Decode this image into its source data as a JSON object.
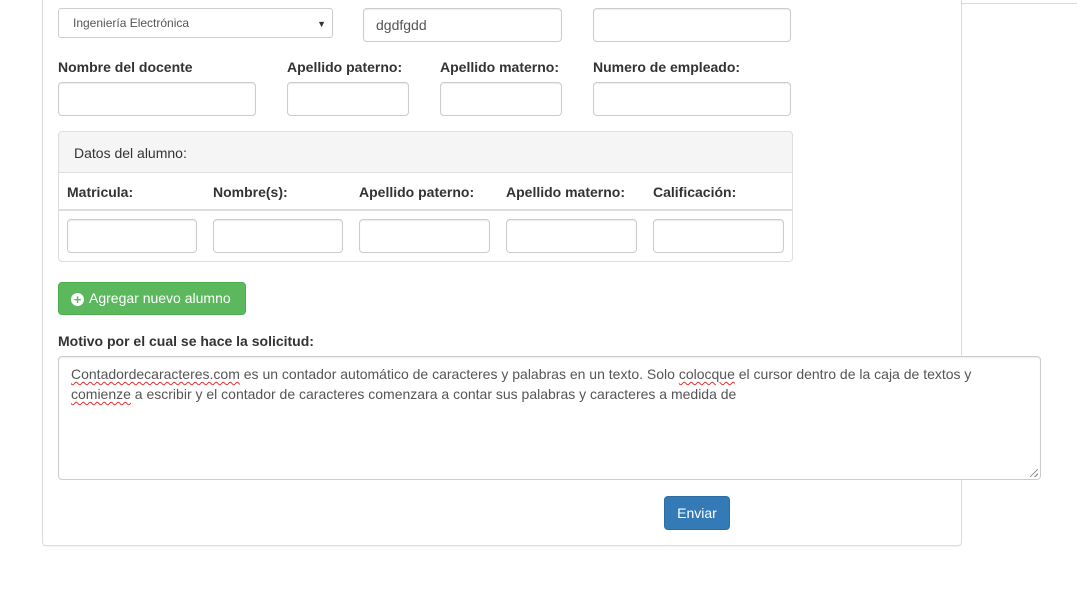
{
  "form": {
    "career_select": {
      "value": "Ingeniería Electrónica"
    },
    "top_input_2_value": "dgdfgdd",
    "top_input_3_value": "",
    "teacher": {
      "name_label": "Nombre del docente",
      "paternal_label": "Apellido paterno:",
      "maternal_label": "Apellido materno:",
      "employee_label": "Numero de empleado:"
    },
    "student_panel": {
      "heading": "Datos del alumno:",
      "columns": [
        "Matricula:",
        "Nombre(s):",
        "Apellido paterno:",
        "Apellido materno:",
        "Calificación:"
      ]
    },
    "add_student_button": "Agregar nuevo alumno",
    "reason_label": "Motivo por el cual se hace la solicitud:",
    "reason_text": {
      "w1": "Contadordecaracteres.com",
      "t1": " es un contador automático de caracteres y palabras en un texto. Solo ",
      "w2": "colocque",
      "t2": " el cursor dentro de la caja de textos y ",
      "w3": "comienze",
      "t3": " a escribir y el contador de caracteres comenzara a contar sus palabras y caracteres a medida de"
    },
    "submit_button": "Enviar"
  }
}
